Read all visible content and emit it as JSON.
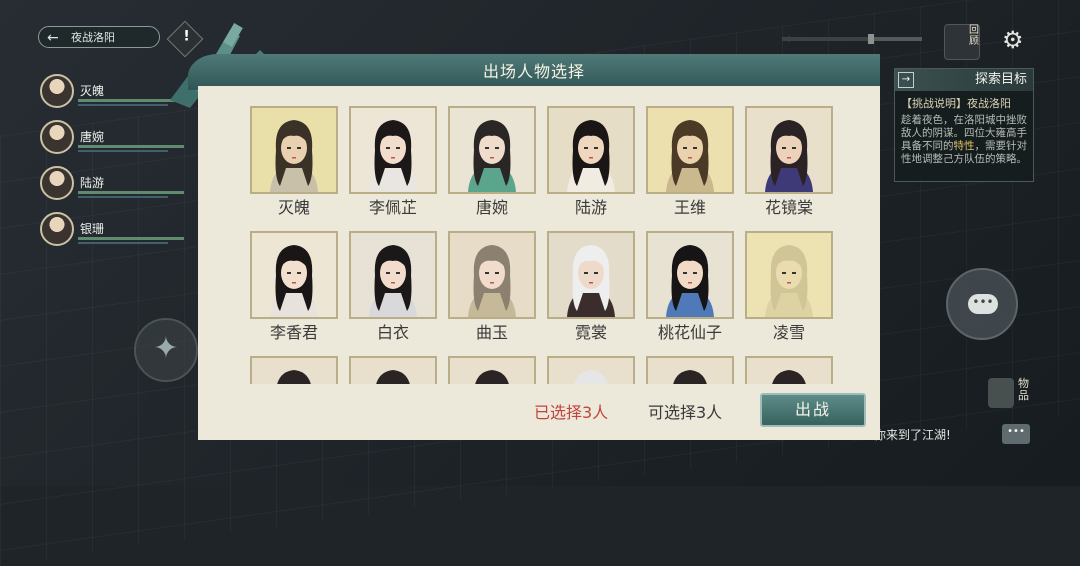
{
  "header": {
    "back_label": "夜战洛阳",
    "warn_mark": "!",
    "review_label": "回顾"
  },
  "party": [
    {
      "name": "灭魄"
    },
    {
      "name": "唐婉"
    },
    {
      "name": "陆游"
    },
    {
      "name": "银珊"
    }
  ],
  "goal": {
    "title": "探索目标",
    "subtitle": "【挑战说明】夜战洛阳",
    "text_a": "趁着夜色，在洛阳城中挫败敌人的阴谋。四位大雍高手具备不同的",
    "text_hl": "特性",
    "text_b": "，需要针对性地调整己方队伍的策略。"
  },
  "modal": {
    "title": "出场人物选择",
    "selected_label": "已选择3人",
    "available_label": "可选择3人",
    "go_label": "出战"
  },
  "characters": [
    {
      "name": "灭魄",
      "bg": "#e9dfa8",
      "hair": "#3a3226",
      "skin": "#e8d0b0",
      "cloth": "#c8c0a8"
    },
    {
      "name": "李佩芷",
      "bg": "#ede6d6",
      "hair": "#1c1818",
      "skin": "#f2dccb",
      "cloth": "#e9e6e2"
    },
    {
      "name": "唐婉",
      "bg": "#eae4d4",
      "hair": "#2a2626",
      "skin": "#f0dcca",
      "cloth": "#5aa58c"
    },
    {
      "name": "陆游",
      "bg": "#e6ddc6",
      "hair": "#1a1616",
      "skin": "#efd6bf",
      "cloth": "#f1ece2"
    },
    {
      "name": "王维",
      "bg": "#ece0ae",
      "hair": "#4a3a26",
      "skin": "#ead2ad",
      "cloth": "#c9b98c"
    },
    {
      "name": "花镜棠",
      "bg": "#e9e0cc",
      "hair": "#2b2226",
      "skin": "#ecd2b8",
      "cloth": "#3e3a78"
    },
    {
      "name": "李香君",
      "bg": "#eee6d4",
      "hair": "#1a1616",
      "skin": "#f3dfcd",
      "cloth": "#e7e2dc"
    },
    {
      "name": "白衣",
      "bg": "#e8e2d6",
      "hair": "#1a1818",
      "skin": "#f2ddcc",
      "cloth": "#d9d9dc"
    },
    {
      "name": "曲玉",
      "bg": "#e6dcc8",
      "hair": "#8c8070",
      "skin": "#f1dccb",
      "cloth": "#c6b99a"
    },
    {
      "name": "霓裳",
      "bg": "#e4dccb",
      "hair": "#eeeeee",
      "skin": "#eedacb",
      "cloth": "#3a2d2c"
    },
    {
      "name": "桃花仙子",
      "bg": "#e8e2d2",
      "hair": "#161414",
      "skin": "#f1dac6",
      "cloth": "#4f79b9"
    },
    {
      "name": "凌雪",
      "bg": "#ede2b2",
      "hair": "#cfc596",
      "skin": "#eadcae",
      "cloth": "#ddd3a2"
    },
    {
      "name": "",
      "bg": "#e8e0cc",
      "hair": "#2a2424",
      "skin": "#efd8c2",
      "cloth": "#888"
    },
    {
      "name": "",
      "bg": "#e8e0cc",
      "hair": "#2a2424",
      "skin": "#efd8c2",
      "cloth": "#888"
    },
    {
      "name": "",
      "bg": "#e8e0cc",
      "hair": "#2a2424",
      "skin": "#efd8c2",
      "cloth": "#888"
    },
    {
      "name": "",
      "bg": "#e8e0cc",
      "hair": "#e6e6e6",
      "skin": "#efd8c2",
      "cloth": "#888"
    },
    {
      "name": "",
      "bg": "#e8e0cc",
      "hair": "#2a2424",
      "skin": "#efd8c2",
      "cloth": "#888"
    },
    {
      "name": "",
      "bg": "#e8e0cc",
      "hair": "#2a2424",
      "skin": "#efd8c2",
      "cloth": "#888"
    }
  ],
  "side": {
    "items_label": "物品",
    "chat_message": "欢迎你来到了江湖!"
  },
  "colors": {
    "accent_teal": "#36625f",
    "selected_red": "#c1453f",
    "modal_bg": "#ece8da"
  }
}
